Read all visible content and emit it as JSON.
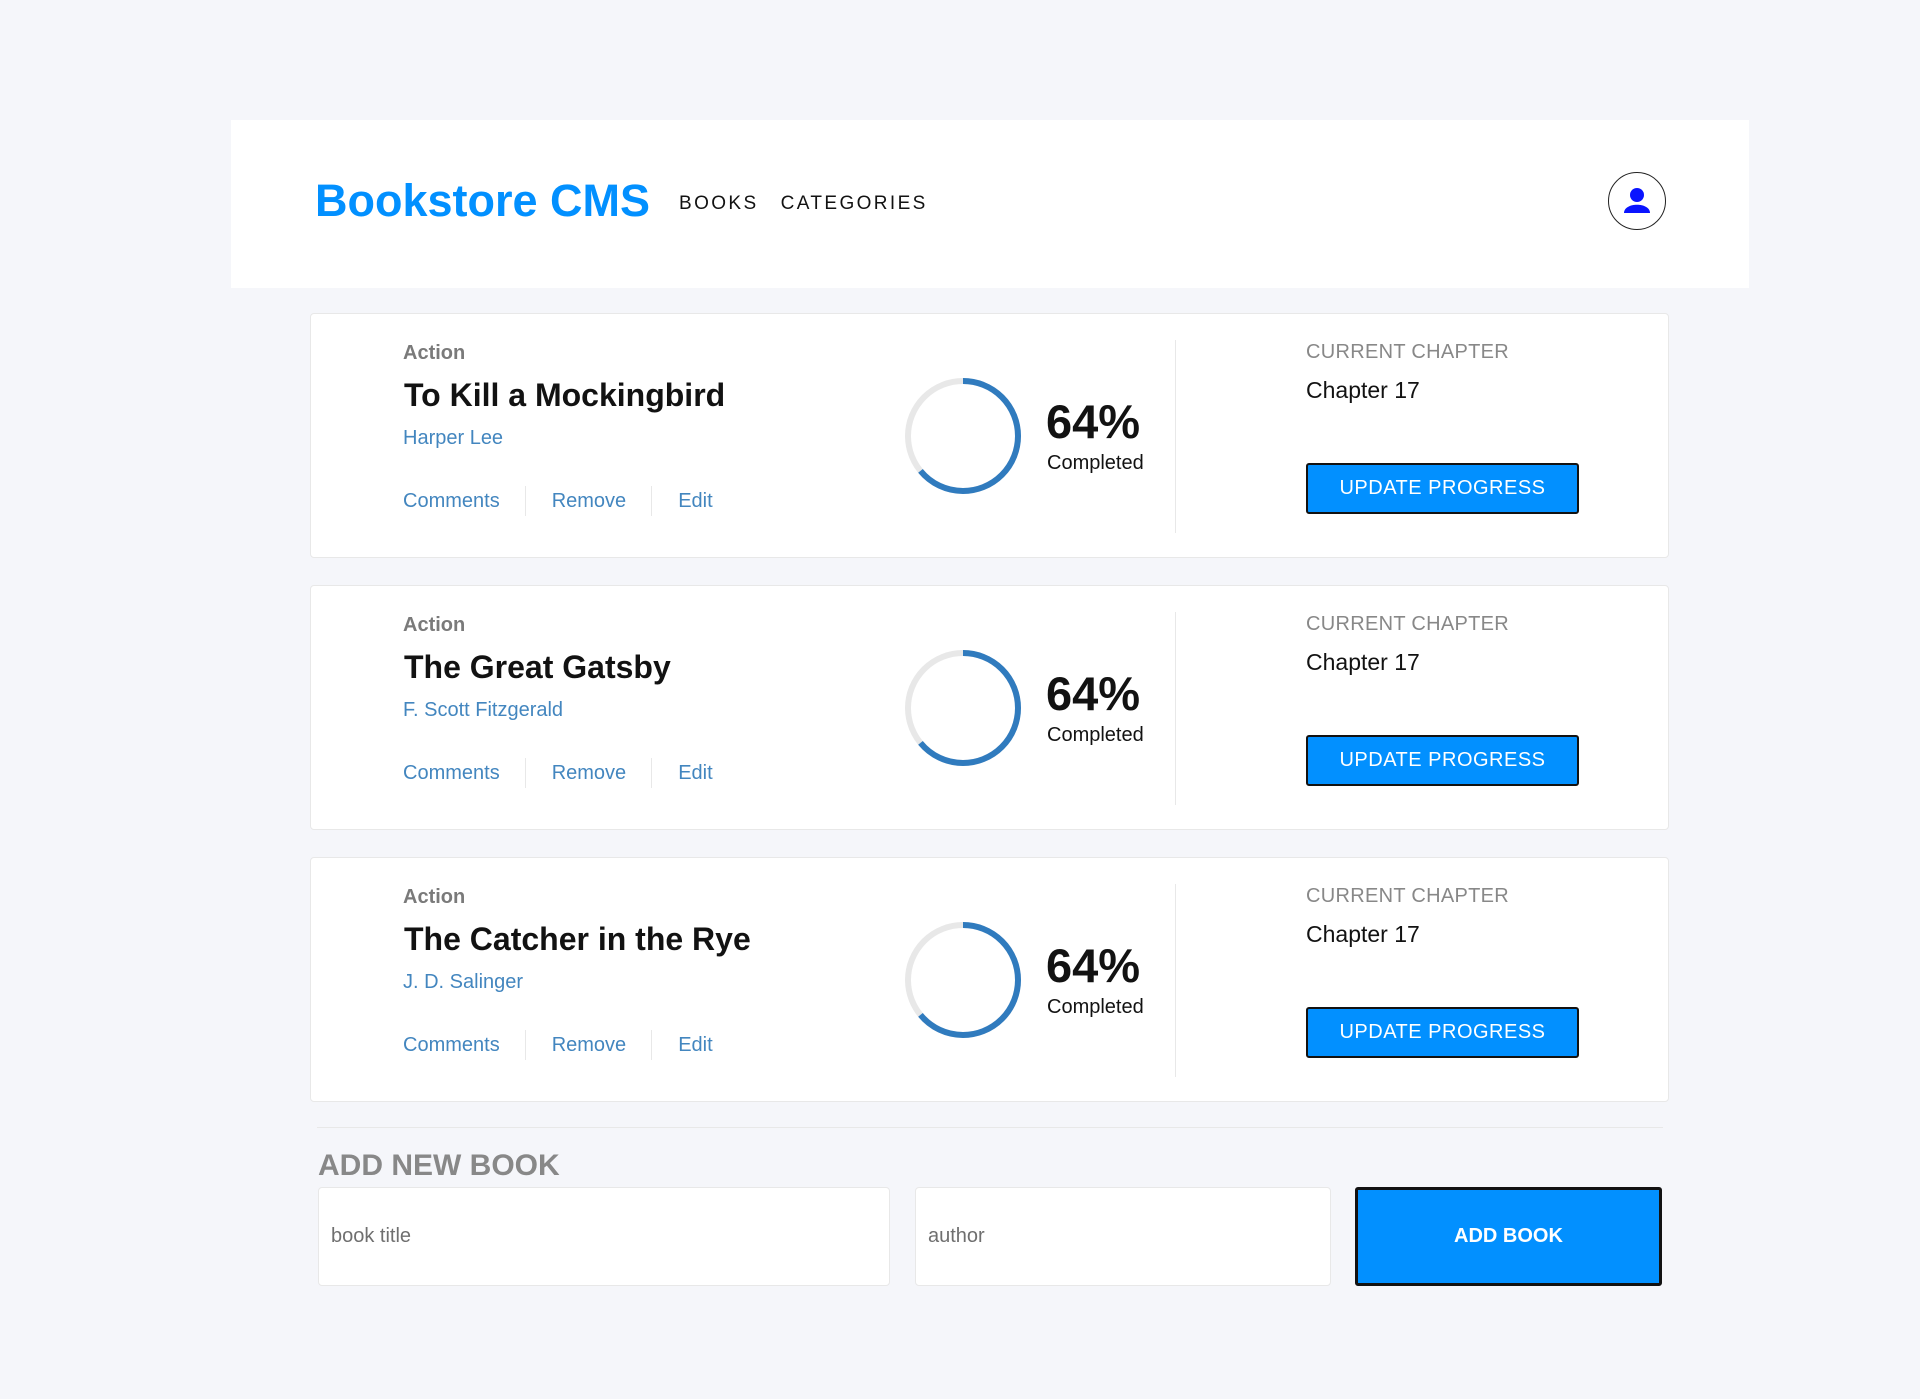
{
  "header": {
    "brand": "Bookstore CMS",
    "nav": [
      "BOOKS",
      "CATEGORIES"
    ]
  },
  "books": [
    {
      "genre": "Action",
      "title": "To Kill a Mockingbird",
      "author": "Harper Lee",
      "actions": [
        "Comments",
        "Remove",
        "Edit"
      ],
      "progress_percent": 64,
      "progress_label": "64%",
      "completed_label": "Completed",
      "chapter_label": "CURRENT CHAPTER",
      "chapter_value": "Chapter 17",
      "update_button": "UPDATE PROGRESS"
    },
    {
      "genre": "Action",
      "title": "The Great Gatsby",
      "author": "F. Scott Fitzgerald",
      "actions": [
        "Comments",
        "Remove",
        "Edit"
      ],
      "progress_percent": 64,
      "progress_label": "64%",
      "completed_label": "Completed",
      "chapter_label": "CURRENT CHAPTER",
      "chapter_value": "Chapter 17",
      "update_button": "UPDATE PROGRESS"
    },
    {
      "genre": "Action",
      "title": "The Catcher in the Rye",
      "author": "J. D. Salinger",
      "actions": [
        "Comments",
        "Remove",
        "Edit"
      ],
      "progress_percent": 64,
      "progress_label": "64%",
      "completed_label": "Completed",
      "chapter_label": "CURRENT CHAPTER",
      "chapter_value": "Chapter 17",
      "update_button": "UPDATE PROGRESS"
    }
  ],
  "add_form": {
    "heading": "ADD NEW BOOK",
    "title_placeholder": "book title",
    "author_placeholder": "author",
    "submit_label": "ADD BOOK"
  },
  "colors": {
    "brand": "#0290ff",
    "link": "#4386bf",
    "progress": "#307bbe",
    "progress_track": "#e8e8e8",
    "background": "#f5f6fa"
  },
  "icons": {
    "user": "user-icon"
  }
}
